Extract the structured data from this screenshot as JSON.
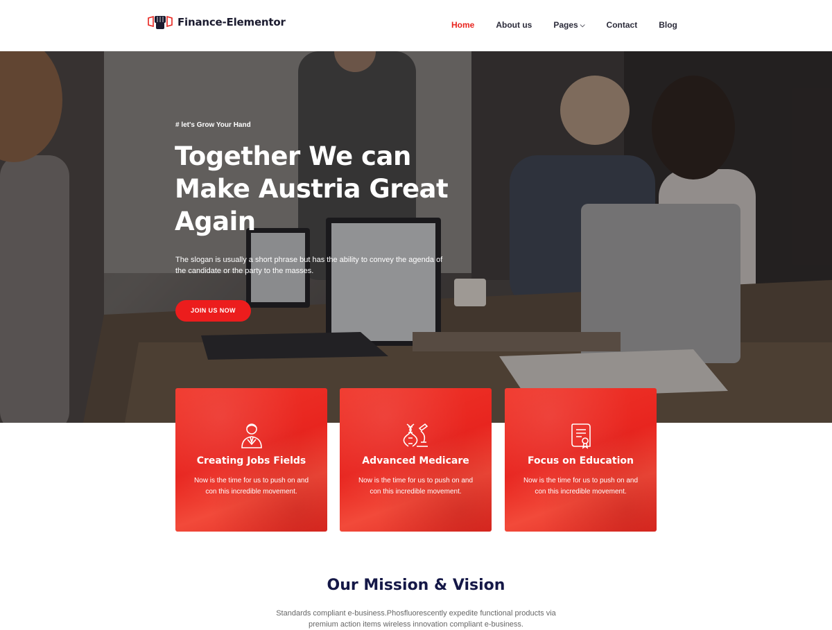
{
  "brand": {
    "name": "Finance-Elementor",
    "accent": "#e8231d",
    "logo_icon": "fist-megaphone-icon"
  },
  "nav": {
    "items": [
      {
        "label": "Home",
        "active": true
      },
      {
        "label": "About us"
      },
      {
        "label": "Pages",
        "dropdown": true
      },
      {
        "label": "Contact"
      },
      {
        "label": "Blog"
      }
    ]
  },
  "hero": {
    "tagline": "# let's Grow Your Hand",
    "title": "Together We can Make Austria Great Again",
    "description": "The slogan is usually a short phrase but has the ability to convey the agenda of the candidate or the party to the masses.",
    "cta": "JOIN US NOW"
  },
  "features": [
    {
      "title": "Creating Jobs Fields",
      "desc": "Now is the time for us to push on and con this incredible movement.",
      "icon": "businessman-icon"
    },
    {
      "title": "Advanced Medicare",
      "desc": "Now is the time for us to push on and con this incredible movement.",
      "icon": "dna-microscope-icon"
    },
    {
      "title": "Focus on Education",
      "desc": "Now is the time for us to push on and con this incredible movement.",
      "icon": "certificate-icon"
    }
  ],
  "mission": {
    "title": "Our Mission & Vision",
    "text": "Standards compliant e-business.Phosfluorescently expedite functional products via premium action items wireless innovation compliant e-business."
  }
}
